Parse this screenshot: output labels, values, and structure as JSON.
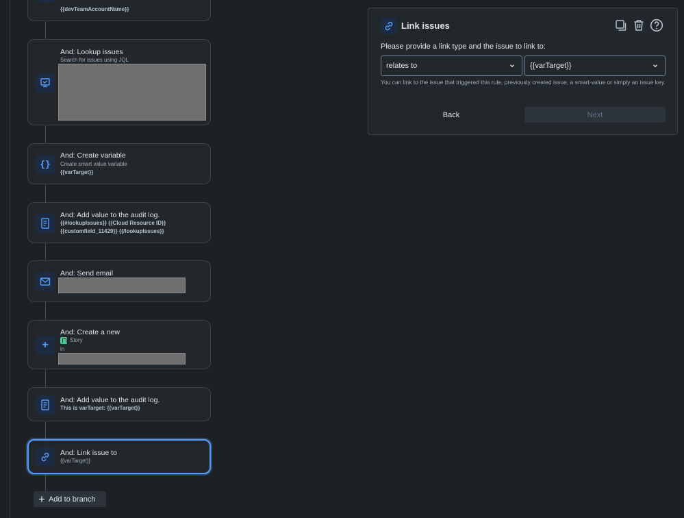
{
  "flow": {
    "top_card": {
      "line": "{{devTeamAccountName}}"
    },
    "lookup": {
      "title": "And: Lookup issues",
      "subtitle": "Search for issues using JQL"
    },
    "create_variable": {
      "title": "And: Create variable",
      "subtitle": "Create smart value variable",
      "value": "{{varTarget}}"
    },
    "audit_log_1": {
      "title": "And: Add value to the audit log.",
      "line1": "{{#lookupIssues}} {{Cloud Resource ID}}",
      "line2": "{{customfield_11429}} {{/lookupIssues}}"
    },
    "send_email": {
      "title": "And: Send email"
    },
    "create_new": {
      "title": "And: Create a new",
      "issue_type": "Story",
      "in_label": "in"
    },
    "audit_log_2": {
      "title": "And: Add value to the audit log.",
      "line1": "This is varTarget: {{varTarget}}"
    },
    "link_issue": {
      "title": "And: Link issue to",
      "value": "{{varTarget}}"
    },
    "add_to_branch": "Add to branch"
  },
  "panel": {
    "title": "Link issues",
    "prompt": "Please provide a link type and the issue to link to:",
    "link_type": "relates to",
    "link_target": "{{varTarget}}",
    "help": "You can link to the issue that triggered this rule, previously created issue, a smart-value or simply an issue key.",
    "back_label": "Back",
    "next_label": "Next"
  },
  "colors": {
    "accent": "#579dff",
    "icon": "#579dff",
    "background": "#1d2125",
    "card": "#22272b"
  }
}
